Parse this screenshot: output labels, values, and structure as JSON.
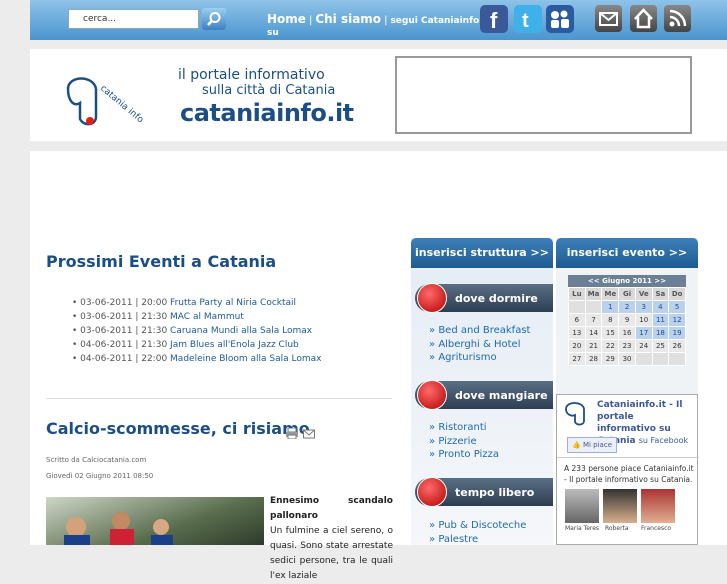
{
  "topbar": {
    "search_placeholder": "cerca...",
    "nav_home": "Home",
    "nav_chi_siamo": "Chi siamo",
    "nav_segui": "segui Cataniainfo",
    "nav_su": "su",
    "separator": "|"
  },
  "header": {
    "tagline_1": "il portale informativo",
    "tagline_2": "sulla città di Catania",
    "site_name": "cataniainfo.it",
    "logo_text": "catania info"
  },
  "events": {
    "title": "Prossimi Eventi a Catania",
    "items": [
      {
        "when": "03-06-2011 | 20:00",
        "name": "Frutta Party al Niria Cocktail"
      },
      {
        "when": "03-06-2011 | 21:30",
        "name": "MAC al Mammut"
      },
      {
        "when": "03-06-2011 | 21:30",
        "name": "Caruana Mundi alla Sala Lomax"
      },
      {
        "when": "04-06-2011 | 21:30",
        "name": "Jam Blues all'Enola Jazz Club"
      },
      {
        "when": "04-06-2011 | 22:00",
        "name": "Madeleine Bloom alla Sala Lomax"
      }
    ]
  },
  "article": {
    "title": "Calcio-scommesse, ci risiamo",
    "byline": "Scritto da Calciocatania.com",
    "date": "Giovedì 02 Giugno 2011 08:50",
    "lead_bold": "Ennesimo scandalo pallonaro",
    "lead_text": "Un fulmine a ciel sereno, o quasi. Sono state arrestate sedici persone, tra le quali l'ex laziale"
  },
  "col1": {
    "header": "inserisci struttura >>",
    "sections": [
      {
        "title": "dove dormire",
        "links": [
          "Bed and Breakfast",
          "Alberghi & Hotel",
          "Agriturismo"
        ]
      },
      {
        "title": "dove mangiare",
        "links": [
          "Ristoranti",
          "Pizzerie",
          "Pronto Pizza"
        ]
      },
      {
        "title": "tempo libero",
        "links": [
          "Pub & Discoteche",
          "Palestre"
        ]
      }
    ],
    "bullet": "»"
  },
  "col2": {
    "header": "inserisci evento >>",
    "calendar": {
      "title": "<< Giugno 2011 >>",
      "days": [
        "Lu",
        "Ma",
        "Me",
        "Gi",
        "Ve",
        "Sa",
        "Do"
      ],
      "weeks": [
        [
          "",
          "",
          "1",
          "2",
          "3",
          "4",
          "5"
        ],
        [
          "6",
          "7",
          "8",
          "9",
          "10",
          "11",
          "12"
        ],
        [
          "13",
          "14",
          "15",
          "16",
          "17",
          "18",
          "19"
        ],
        [
          "20",
          "21",
          "22",
          "23",
          "24",
          "25",
          "26"
        ],
        [
          "27",
          "28",
          "29",
          "30",
          "",
          "",
          ""
        ]
      ]
    },
    "facebook": {
      "page_title": "Cataniainfo.it - Il portale informativo su Catania",
      "on_facebook": "su Facebook",
      "like_button": "Mi piace",
      "likes_text": "A 233 persone piace Cataniainfo.it - Il portale informativo su Catania.",
      "fans": [
        "Maria Teres",
        "Roberta",
        "Francesco"
      ]
    }
  },
  "colors": {
    "brand_blue": "#1c4e86",
    "link_blue": "#1e6ab2",
    "topbar": "#4a95cf"
  }
}
